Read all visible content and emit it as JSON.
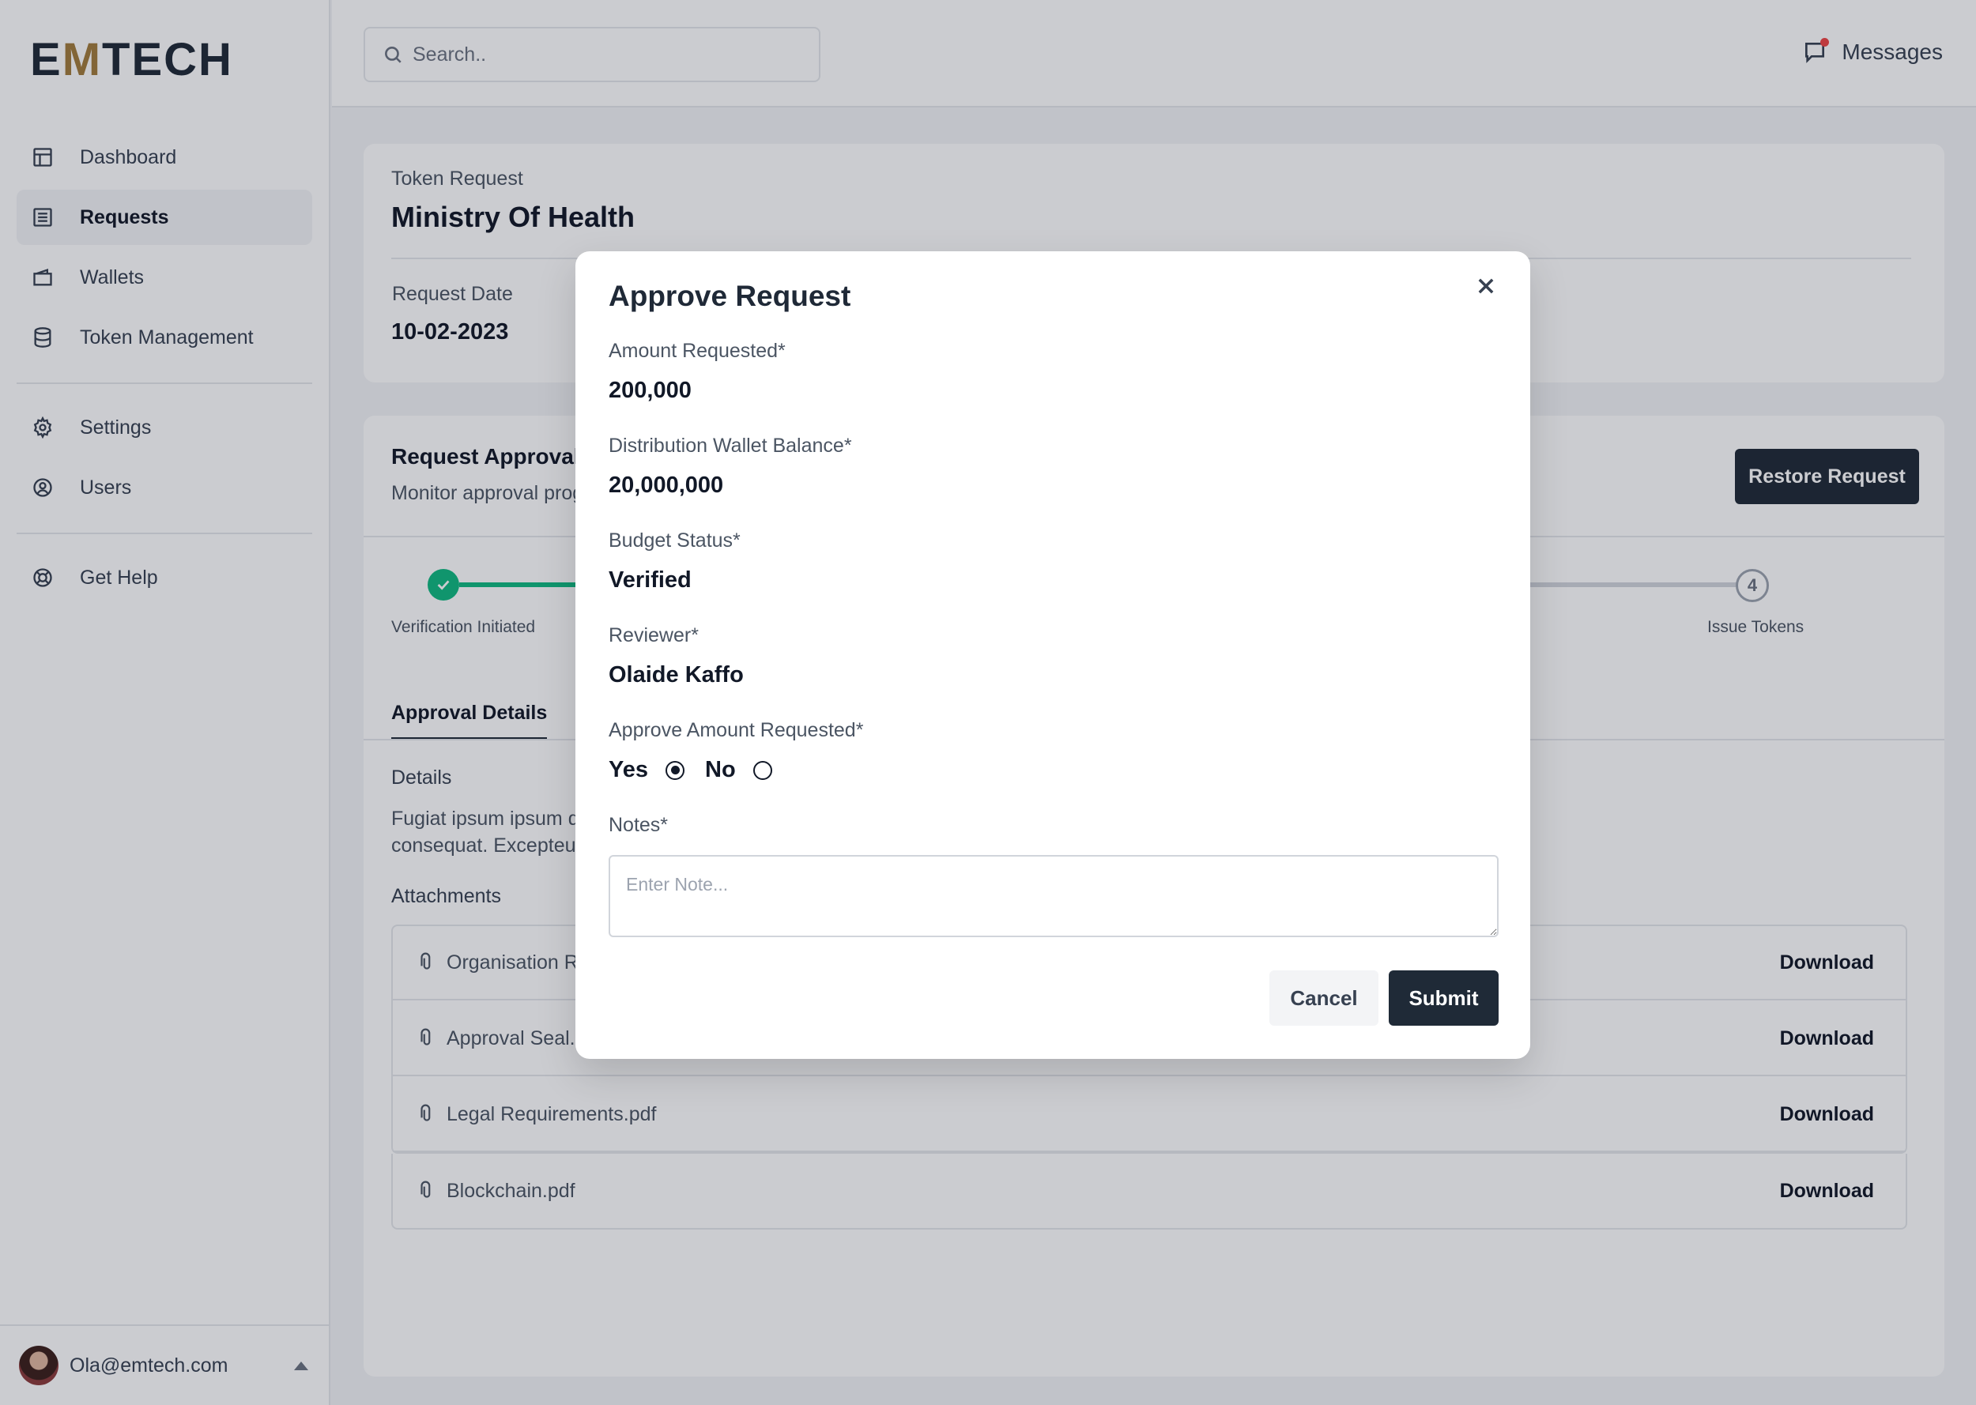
{
  "sidebar": {
    "logo_pre": "E",
    "logo_m": "M",
    "logo_post": "TECH",
    "items": [
      {
        "label": "Dashboard",
        "icon": "dashboard-icon"
      },
      {
        "label": "Requests",
        "icon": "list-icon"
      },
      {
        "label": "Wallets",
        "icon": "wallet-icon"
      },
      {
        "label": "Token Management",
        "icon": "database-icon"
      },
      {
        "label": "Settings",
        "icon": "gear-icon"
      },
      {
        "label": "Users",
        "icon": "user-circle-icon"
      },
      {
        "label": "Get Help",
        "icon": "help-icon"
      }
    ],
    "user_email": "Ola@emtech.com"
  },
  "topbar": {
    "search_placeholder": "Search..",
    "messages_label": "Messages"
  },
  "request": {
    "type": "Token Request",
    "org": "Ministry Of Health",
    "date_label": "Request Date",
    "date_value": "10-02-2023"
  },
  "approval": {
    "title": "Request Approval S",
    "subtitle": "Monitor approval prog",
    "restore_button": "Restore Request",
    "steps": [
      {
        "label": "Verification Initiated",
        "status": "done"
      },
      {
        "label": "Issue Tokens",
        "number": "4",
        "status": "pending"
      }
    ],
    "tab": "Approval Details",
    "details_label": "Details",
    "details_text_1": "Fugiat ipsum ipsum de",
    "details_text_2": "consequat. Excepteur",
    "attachments_label": "Attachments",
    "attachments": [
      {
        "name": "Organisation Re",
        "action": "Download"
      },
      {
        "name": "Approval Seal.p",
        "action": "Download"
      },
      {
        "name": "Legal Requirements.pdf",
        "action": "Download"
      },
      {
        "name": "Blockchain.pdf",
        "action": "Download"
      }
    ]
  },
  "modal": {
    "title": "Approve Request",
    "fields": [
      {
        "label": "Amount Requested*",
        "value": "200,000"
      },
      {
        "label": "Distribution Wallet Balance*",
        "value": "20,000,000"
      },
      {
        "label": "Budget Status*",
        "value": "Verified"
      },
      {
        "label": "Reviewer*",
        "value": "Olaide Kaffo"
      }
    ],
    "approve_label": "Approve Amount Requested*",
    "option_yes": "Yes",
    "option_no": "No",
    "selected": "Yes",
    "notes_label": "Notes*",
    "notes_placeholder": "Enter Note...",
    "cancel_label": "Cancel",
    "submit_label": "Submit"
  },
  "colors": {
    "primary": "#1f2a37",
    "success": "#10b981",
    "logo_accent": "#a27b3c"
  }
}
